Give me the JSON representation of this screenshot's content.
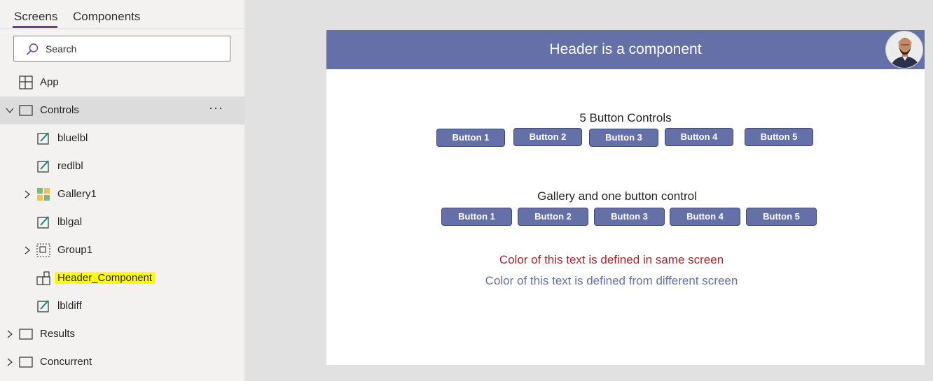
{
  "tabs": {
    "screens": "Screens",
    "components": "Components"
  },
  "search": {
    "placeholder": "Search"
  },
  "tree": {
    "app": "App",
    "controls": "Controls",
    "controls_more": "···",
    "bluelbl": "bluelbl",
    "redlbl": "redlbl",
    "gallery1": "Gallery1",
    "lblgal": "lblgal",
    "group1": "Group1",
    "header_component": "Header_Component",
    "lbldiff": "lbldiff",
    "results": "Results",
    "concurrent": "Concurrent"
  },
  "canvas": {
    "header_title": "Header is a component",
    "caption1": "5 Button Controls",
    "buttons_row1": [
      "Button 1",
      "Button 2",
      "Button 3",
      "Button 4",
      "Button 5"
    ],
    "caption2": "Gallery and one button control",
    "buttons_row2": [
      "Button 1",
      "Button 2",
      "Button 3",
      "Button 4",
      "Button 5"
    ],
    "red_text": "Color of this text is defined in same screen",
    "blue_text": "Color of this text is defined from different screen"
  },
  "colors": {
    "accent_tab": "#6b3f8f",
    "header_bg": "#6670a8",
    "button_bg": "#6670a8",
    "red_text": "#a4262c",
    "blue_text": "#6670a8",
    "highlight": "#ffff00"
  }
}
